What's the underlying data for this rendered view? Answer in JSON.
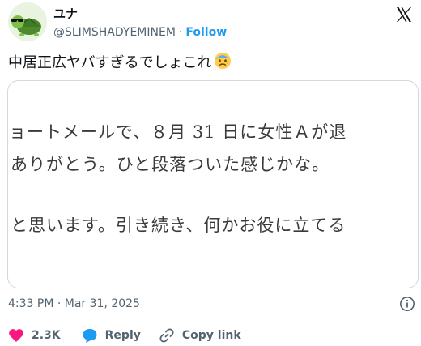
{
  "author": {
    "display_name": "ユナ",
    "handle": "@SLIMSHADYEMINEM",
    "separator": "·",
    "follow_label": "Follow",
    "avatar_icon": "turtle-with-sunglasses-icon"
  },
  "tweet": {
    "text": "中居正広ヤバすぎるでしょこれ",
    "emoji": "anxious-face-with-sweat-icon"
  },
  "media": {
    "lines": [
      "ョートメールで、８月 31 日に女性Ａが退",
      "ありがとう。ひと段落ついた感じかな。",
      "と思います。引き続き、何かお役に立てる"
    ]
  },
  "meta": {
    "timestamp": "4:33 PM · Mar 31, 2025"
  },
  "actions": {
    "like_count": "2.3K",
    "reply_label": "Reply",
    "copy_link_label": "Copy link"
  },
  "colors": {
    "accent": "#1d9bf0",
    "like": "#f91880",
    "secondary_text": "#536471",
    "border": "#cfd9de"
  }
}
